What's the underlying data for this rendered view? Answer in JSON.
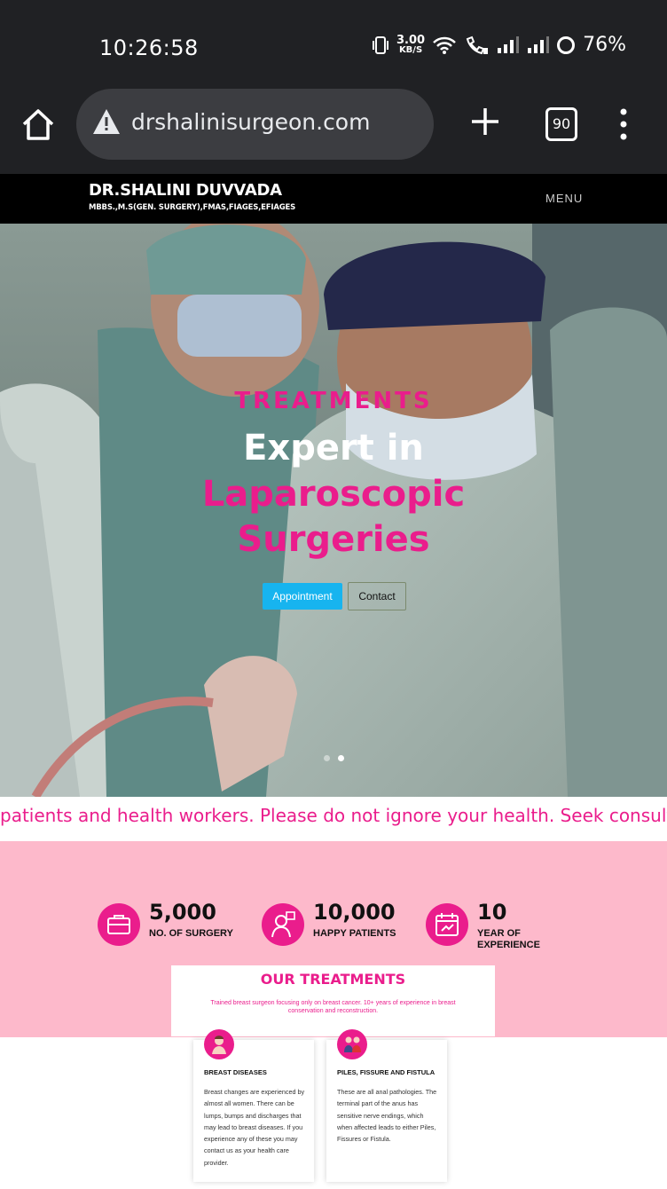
{
  "status_bar": {
    "time": "10:26:58",
    "net_speed_value": "3.00",
    "net_speed_unit": "KB/S",
    "battery": "76%"
  },
  "browser": {
    "url": "drshalinisurgeon.com",
    "tab_count": "90"
  },
  "site_header": {
    "name": "DR.SHALINI DUVVADA",
    "credentials": "MBBS.,M.S(GEN. SURGERY),FMAS,FIAGES,EFIAGES",
    "menu_label": "MENU"
  },
  "hero": {
    "kicker": "TREATMENTS",
    "headline_line1": "Expert in",
    "headline_line2": "Laparoscopic",
    "headline_line3": "Surgeries",
    "appointment_label": "Appointment",
    "contact_label": "Contact",
    "slide_count": 2,
    "active_slide": 2
  },
  "marquee": {
    "text": "patients and health workers. Please do not ignore your health. Seek consultation"
  },
  "stats": [
    {
      "value": "5,000",
      "label": "NO. OF SURGERY",
      "icon": "briefcase-icon"
    },
    {
      "value": "10,000",
      "label": "HAPPY PATIENTS",
      "icon": "patient-icon"
    },
    {
      "value": "10",
      "label_line1": "YEAR OF",
      "label_line2": "EXPERIENCE",
      "icon": "calendar-icon"
    }
  ],
  "treatments": {
    "title": "OUR TREATMENTS",
    "subtitle": "Trained breast surgeon focusing only on breast cancer. 10+ years of experience in breast conservation and reconstruction.",
    "cards": [
      {
        "title": "BREAST DISEASES",
        "body": "Breast changes are experienced by almost all women. There can be lumps, bumps and discharges that may lead to breast diseases. If you experience any of these you may contact us as your health care provider.",
        "icon": "breast-icon"
      },
      {
        "title": "PILES, FISSURE AND FISTULA",
        "body": "These are all anal pathologies. The terminal part of the anus has sensitive nerve endings, which when affected leads to either Piles, Fissures or Fistula.",
        "icon": "consultation-icon"
      }
    ]
  },
  "colors": {
    "accent_pink": "#ea1d8c",
    "band_pink": "#fdb9cb",
    "appointment_blue": "#17b4ef",
    "browser_dark": "#202124"
  }
}
